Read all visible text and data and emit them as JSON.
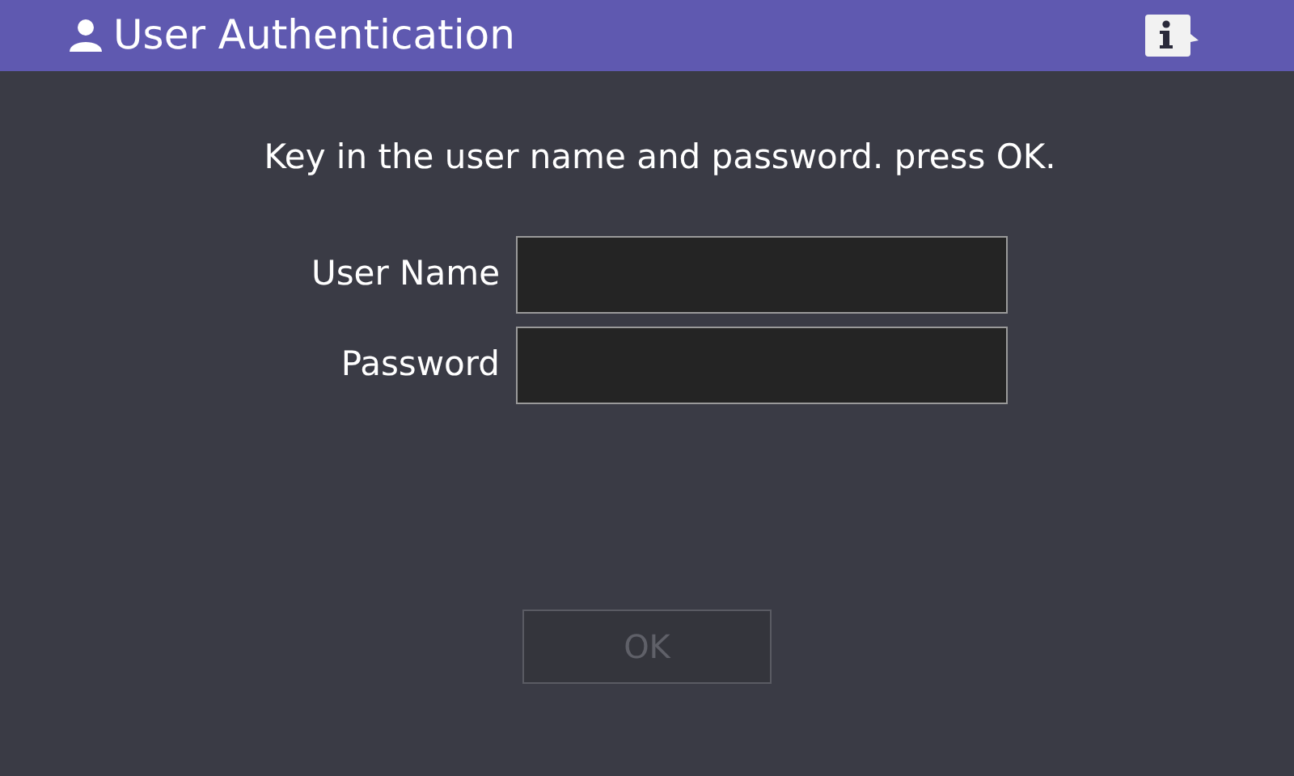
{
  "header": {
    "title": "User Authentication"
  },
  "instruction": "Key in the user name and password. press OK.",
  "fields": [
    {
      "label": "User Name"
    },
    {
      "label": "Password"
    }
  ],
  "ok_button": {
    "label": "OK",
    "disabled": true
  }
}
